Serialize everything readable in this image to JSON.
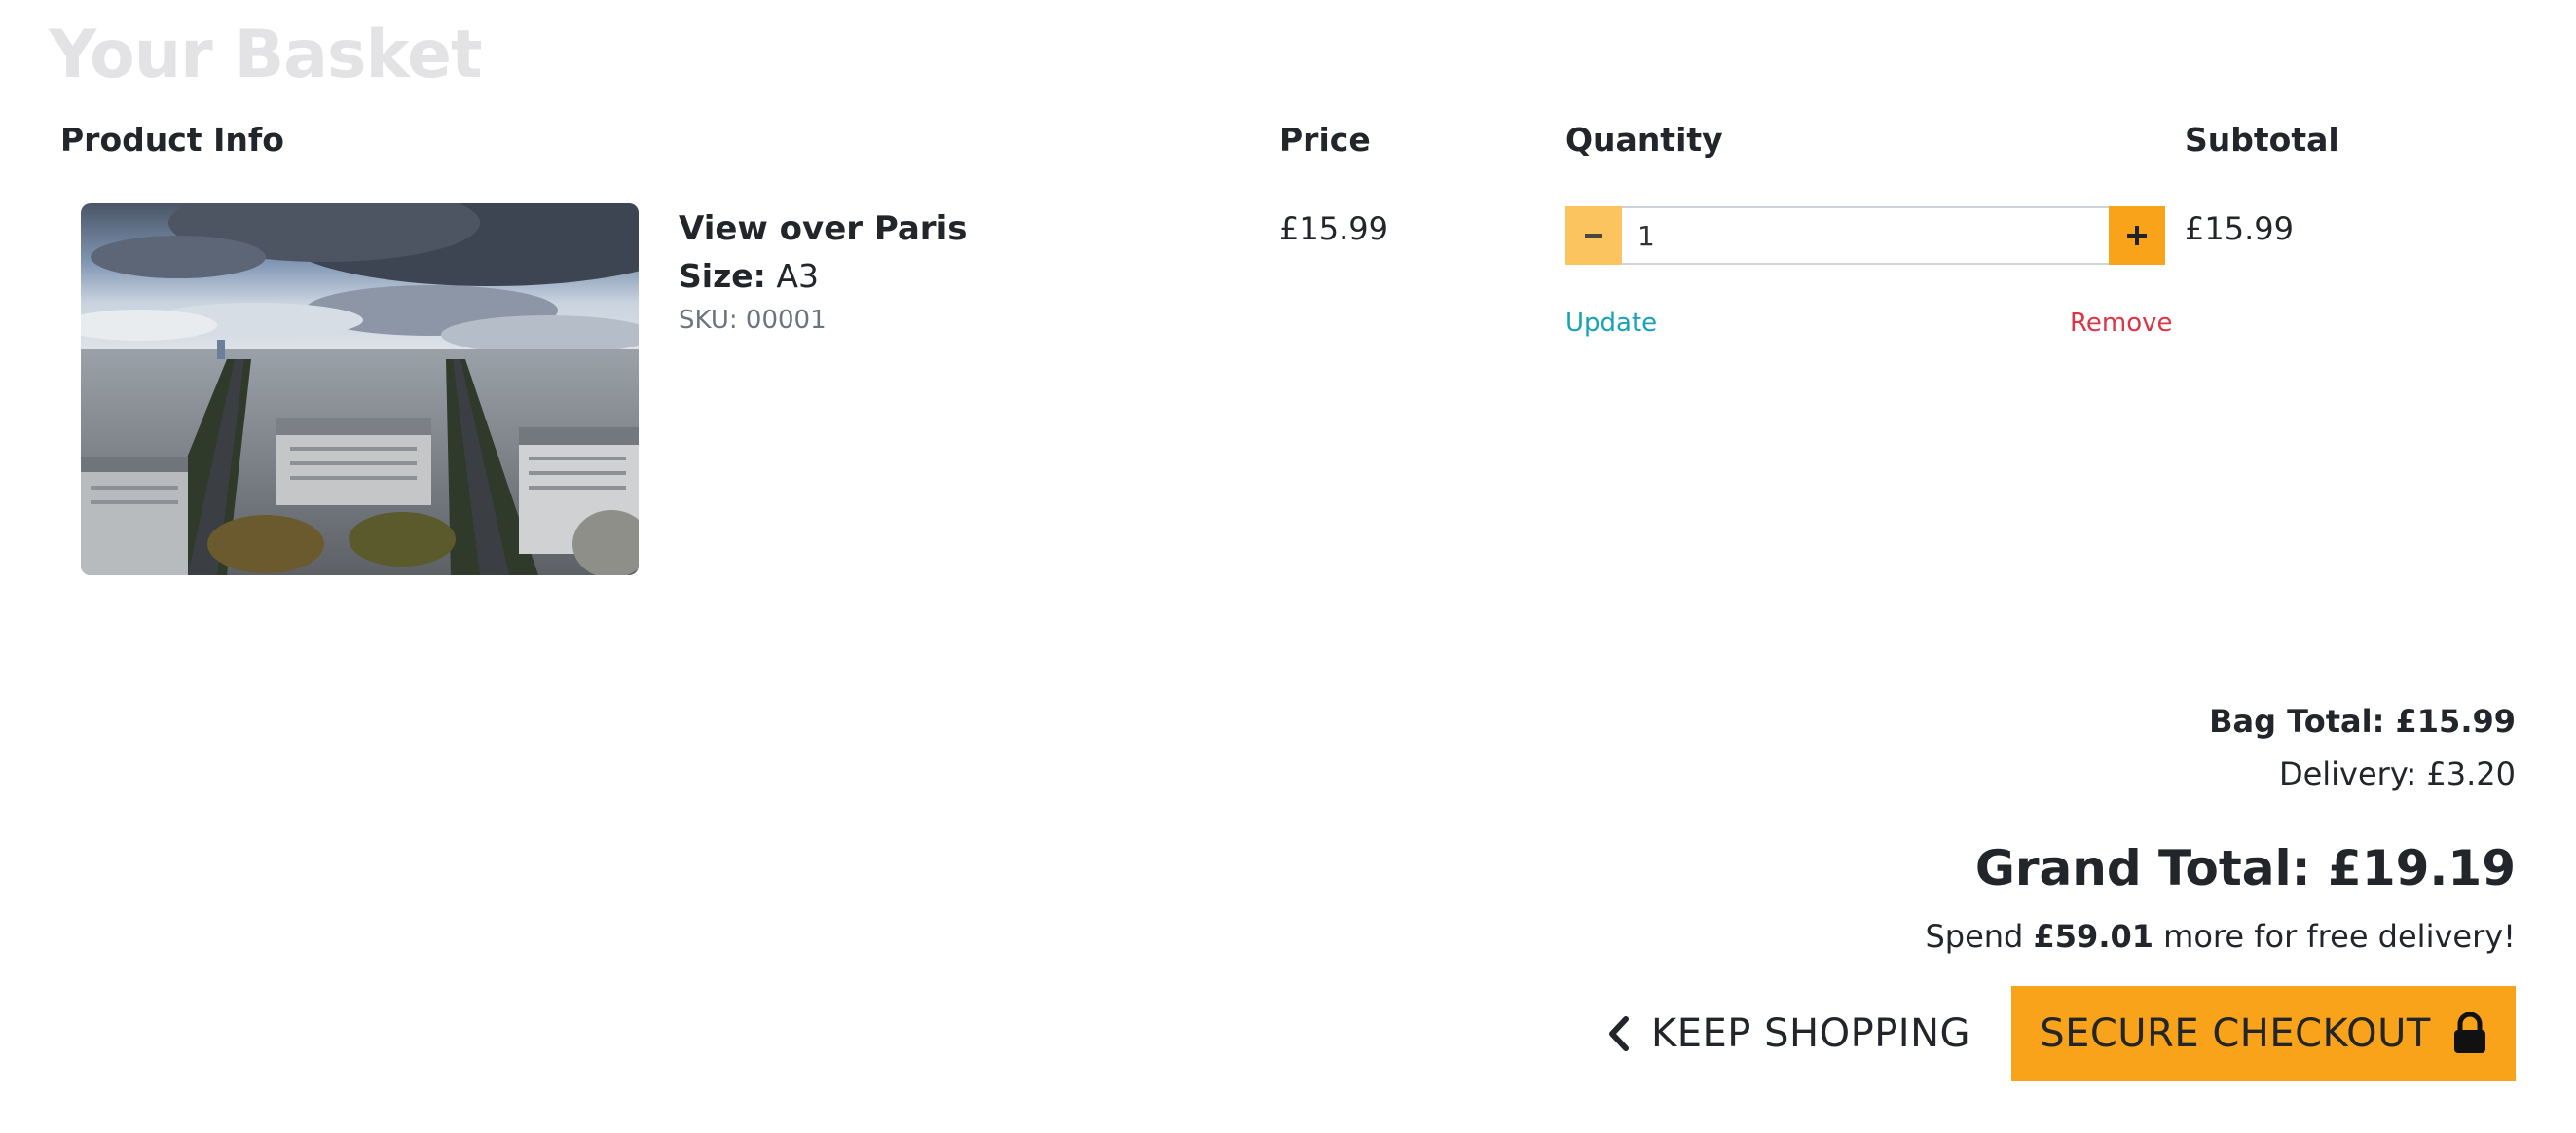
{
  "page": {
    "title": "Your Basket"
  },
  "table": {
    "headers": {
      "product": "Product Info",
      "price": "Price",
      "quantity": "Quantity",
      "subtotal": "Subtotal"
    }
  },
  "items": [
    {
      "name": "View over Paris",
      "size_label": "Size:",
      "size_value": "A3",
      "sku": "SKU: 00001",
      "price": "£15.99",
      "quantity": "1",
      "subtotal": "£15.99",
      "update_label": "Update",
      "remove_label": "Remove",
      "image": "paris-rooftops-photo"
    }
  ],
  "summary": {
    "bag_total": "Bag Total: £15.99",
    "delivery": "Delivery: £3.20",
    "grand_total": "Grand Total: £19.19",
    "free_delivery_prefix": "Spend",
    "free_delivery_amount": "£59.01",
    "free_delivery_suffix": "more for free delivery!"
  },
  "actions": {
    "keep_shopping": "KEEP SHOPPING",
    "secure_checkout": "SECURE CHECKOUT"
  },
  "icons": {
    "minus": "minus-icon",
    "plus": "plus-icon",
    "back": "chevron-left-icon",
    "lock": "lock-icon"
  },
  "colors": {
    "accent": "#f9a31a",
    "accent_light": "#fcc45e",
    "update_link": "#17a2b8",
    "remove_link": "#dc3545",
    "title_muted": "#e3e3e5"
  }
}
